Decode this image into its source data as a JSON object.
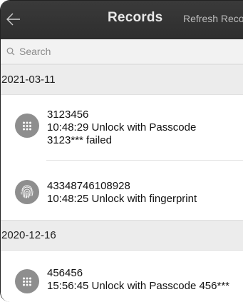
{
  "header": {
    "title": "Records",
    "refresh_label": "Refresh Records"
  },
  "search": {
    "placeholder": "Search"
  },
  "groups": [
    {
      "date": "2021-03-11",
      "records": [
        {
          "id": "3123456",
          "line2": "10:48:29 Unlock with Passcode",
          "line3": "3123*** failed",
          "icon": "keypad-icon"
        },
        {
          "id": "43348746108928",
          "line2": "10:48:25 Unlock with fingerprint",
          "icon": "fingerprint-icon"
        }
      ]
    },
    {
      "date": "2020-12-16",
      "records": [
        {
          "id": "456456",
          "line2": "15:56:45 Unlock with Passcode 456***",
          "icon": "keypad-icon"
        }
      ]
    }
  ],
  "colors": {
    "topbar": "#333333",
    "date_header": "#ececec",
    "avatar": "#8e8e8e"
  }
}
